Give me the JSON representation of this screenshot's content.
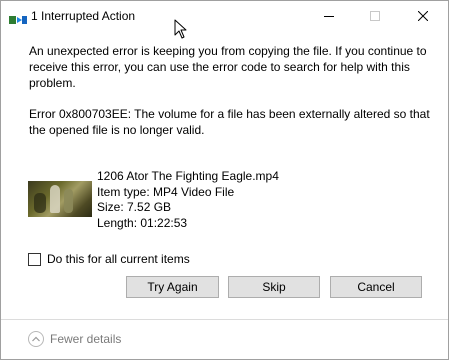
{
  "window": {
    "title": "1 Interrupted Action",
    "min_label": "minimize",
    "max_label": "maximize",
    "close_label": "close"
  },
  "message": "An unexpected error is keeping you from copying the file. If you continue to receive this error, you can use the error code to search for help with this problem.",
  "error_text": "Error 0x800703EE: The volume for a file has been externally altered so that the opened file is no longer valid.",
  "file": {
    "name": "1206 Ator The Fighting Eagle.mp4",
    "type": "Item type: MP4 Video File",
    "size": "Size: 7.52 GB",
    "length": "Length: 01:22:53"
  },
  "apply_all": {
    "label": "Do this for all current items",
    "checked": false
  },
  "buttons": {
    "try_again": "Try Again",
    "skip": "Skip",
    "cancel": "Cancel"
  },
  "footer": {
    "details_label": "Fewer details"
  },
  "icons": {
    "title": "file-transfer-icon",
    "details": "chevron-up-icon"
  },
  "colors": {
    "button_bg": "#e1e1e1",
    "button_border": "#adadad",
    "footer_text": "#7a7a7a"
  }
}
